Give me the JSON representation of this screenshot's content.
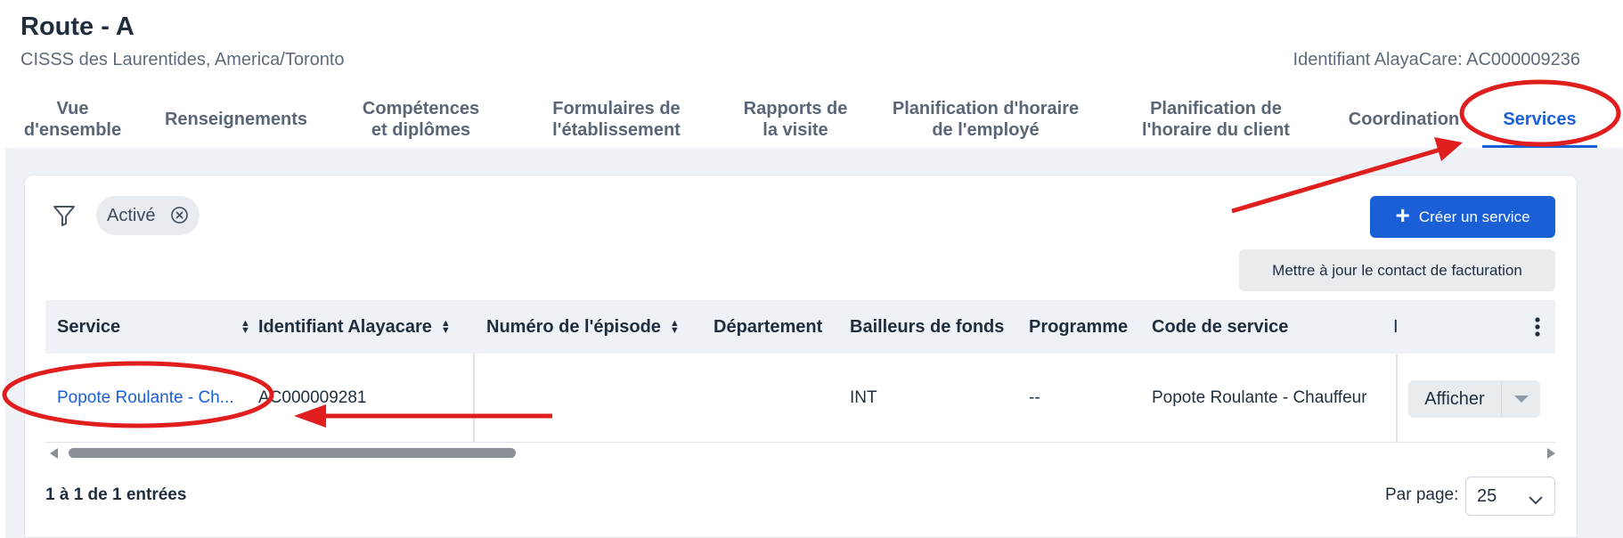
{
  "header": {
    "title": "Route - A",
    "subtitle": "CISSS des Laurentides, America/Toronto",
    "identifier": "Identifiant AlayaCare: AC000009236"
  },
  "tabs": [
    {
      "line1": "Vue",
      "line2": "d'ensemble",
      "active": false
    },
    {
      "line1": "Renseignements",
      "line2": "",
      "active": false
    },
    {
      "line1": "Compétences",
      "line2": "et diplômes",
      "active": false
    },
    {
      "line1": "Formulaires de",
      "line2": "l'établissement",
      "active": false
    },
    {
      "line1": "Rapports de",
      "line2": "la visite",
      "active": false
    },
    {
      "line1": "Planification d'horaire",
      "line2": "de l'employé",
      "active": false
    },
    {
      "line1": "Planification de",
      "line2": "l'horaire du client",
      "active": false
    },
    {
      "line1": "Coordination",
      "line2": "",
      "active": false
    },
    {
      "line1": "Services",
      "line2": "",
      "active": true
    }
  ],
  "filter": {
    "chip_label": "Activé"
  },
  "actions": {
    "create_label": "Créer un service",
    "update_billing_label": "Mettre à jour le contact de facturation"
  },
  "table": {
    "columns": [
      "Service",
      "Identifiant Alayacare",
      "Numéro de l'épisode",
      "Département",
      "Bailleurs de fonds",
      "Programme",
      "Code de service",
      "I"
    ],
    "rows": [
      {
        "service": "Popote Roulante - Ch...",
        "identifiant": "AC000009281",
        "episode": "",
        "departement": "",
        "bailleurs": "INT",
        "programme": "--",
        "code": "Popote Roulante - Chauffeur",
        "action": "Afficher"
      }
    ]
  },
  "footer": {
    "entries": "1 à 1 de 1 entrées",
    "per_page_label": "Par page:",
    "per_page_value": "25"
  },
  "colors": {
    "accent": "#1a5fd6",
    "annotation": "#e01e1e"
  }
}
